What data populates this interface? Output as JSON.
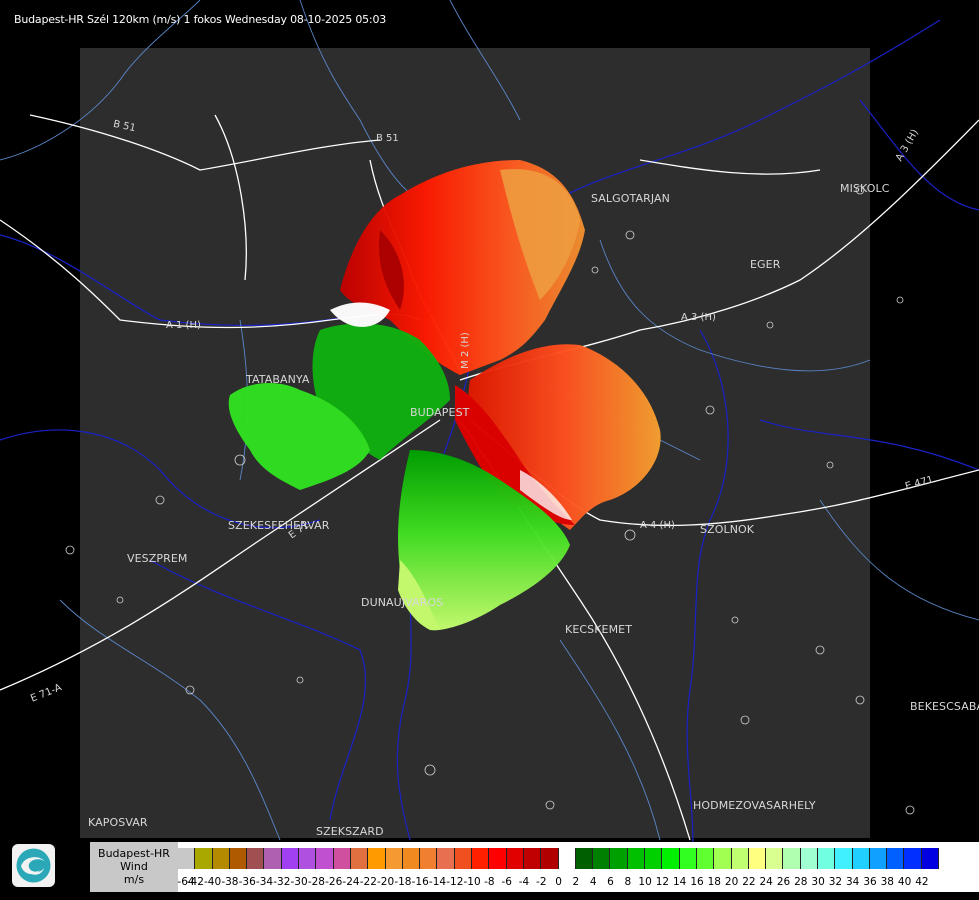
{
  "header": {
    "title": "Budapest-HR Szél 120km (m/s) 1 fokos Wednesday 08-10-2025 05:03"
  },
  "cities": {
    "salgotarjan": "SALGOTARJAN",
    "miskolc": "MISKOLC",
    "eger": "EGER",
    "tatabanya": "TATABANYA",
    "budapest": "BUDAPEST",
    "szekesfehervar": "SZEKESFEHERVAR",
    "veszprem": "VESZPREM",
    "szolnok": "SZOLNOK",
    "dunaujvaros": "DUNAUJVAROS",
    "kecskemet": "KECSKEMET",
    "bekescsaba": "BEKESCSABA",
    "hodmezovasarhely": "HODMEZOVASARHELY",
    "kaposvar": "KAPOSVAR",
    "szekszard": "SZEKSZARD"
  },
  "roads": {
    "b51_top": "B 51",
    "b51_mid": "B 51",
    "a1": "A 1 (H)",
    "a3": "A 3 (H)",
    "a3_ne": "A 3 (H)",
    "a4": "A 4 (H)",
    "e471": "E 471",
    "e71_sw": "E 71-A",
    "e71": "E 71",
    "m2": "M 2 (H)"
  },
  "legend": {
    "station": "Budapest-HR",
    "product": "Wind",
    "unit": "m/s",
    "colors": [
      "#c8c8c8",
      "#a8a800",
      "#b48a00",
      "#b05a00",
      "#a05050",
      "#b060b0",
      "#a040f0",
      "#b050e0",
      "#c050d0",
      "#d050a0",
      "#e07040",
      "#ff9a00",
      "#f59a30",
      "#f08a20",
      "#f08030",
      "#e87050",
      "#f05020",
      "#ff2000",
      "#ff0000",
      "#e00000",
      "#c00000",
      "#b00000",
      "#ffffff",
      "#006000",
      "#008000",
      "#00a000",
      "#00c000",
      "#00d000",
      "#00f000",
      "#30ff20",
      "#60ff30",
      "#a0ff50",
      "#c0ff70",
      "#ffff80",
      "#d8ff90",
      "#b0ffb0",
      "#a0ffd0",
      "#70ffe0",
      "#40f0ff",
      "#20d0ff",
      "#10a0ff",
      "#0060ff",
      "#0030ff",
      "#0000e0"
    ],
    "ticks": [
      "-64",
      "-42",
      "-40",
      "-38",
      "-36",
      "-34",
      "-32",
      "-30",
      "-28",
      "-26",
      "-24",
      "-22",
      "-20",
      "-18",
      "-16",
      "-14",
      "-12",
      "-10",
      "-8",
      "-6",
      "-4",
      "-2",
      "0",
      "2",
      "4",
      "6",
      "8",
      "10",
      "12",
      "14",
      "16",
      "18",
      "20",
      "22",
      "24",
      "26",
      "28",
      "30",
      "32",
      "34",
      "36",
      "38",
      "40",
      "42"
    ]
  },
  "icons": {
    "logo": "omsz-logo-icon"
  }
}
